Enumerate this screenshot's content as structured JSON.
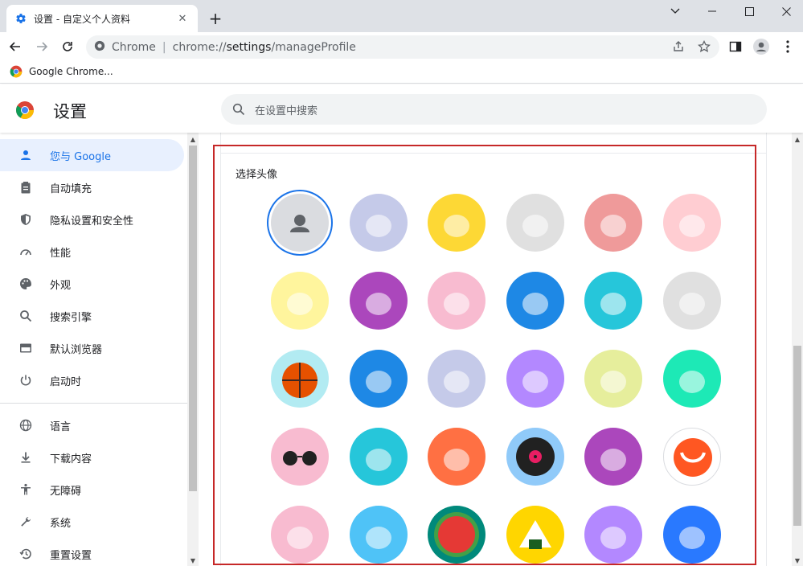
{
  "browser": {
    "tab_title": "设置 - 自定义个人资料",
    "omnibox_scheme": "Chrome",
    "omnibox_url_host": "chrome://",
    "omnibox_url_path": "settings",
    "omnibox_url_rest": "/manageProfile",
    "bookmark_label": "Google Chrome..."
  },
  "settings": {
    "title": "设置",
    "search_placeholder": "在设置中搜索"
  },
  "sidebar": {
    "items": [
      {
        "label": "您与 Google",
        "icon": "person-icon",
        "active": true
      },
      {
        "label": "自动填充",
        "icon": "clipboard-icon"
      },
      {
        "label": "隐私设置和安全性",
        "icon": "shield-icon"
      },
      {
        "label": "性能",
        "icon": "speedometer-icon"
      },
      {
        "label": "外观",
        "icon": "palette-icon"
      },
      {
        "label": "搜索引擎",
        "icon": "search-icon"
      },
      {
        "label": "默认浏览器",
        "icon": "browser-window-icon"
      },
      {
        "label": "启动时",
        "icon": "power-icon"
      },
      {
        "label": "语言",
        "icon": "globe-icon"
      },
      {
        "label": "下载内容",
        "icon": "download-icon"
      },
      {
        "label": "无障碍",
        "icon": "accessibility-icon"
      },
      {
        "label": "系统",
        "icon": "wrench-icon"
      },
      {
        "label": "重置设置",
        "icon": "restore-icon"
      }
    ]
  },
  "avatar_section": {
    "title": "选择头像",
    "avatars": [
      {
        "name": "default-person",
        "bg": "#dadce0",
        "selected": true
      },
      {
        "name": "cat",
        "bg": "#c5cae9"
      },
      {
        "name": "corgi",
        "bg": "#fdd835"
      },
      {
        "name": "dragon",
        "bg": "#e0e0e0"
      },
      {
        "name": "elephant",
        "bg": "#ef9a9a"
      },
      {
        "name": "fox",
        "bg": "#ffcdd2"
      },
      {
        "name": "monkey",
        "bg": "#fff59d"
      },
      {
        "name": "panda",
        "bg": "#ab47bc"
      },
      {
        "name": "penguin",
        "bg": "#f8bbd0"
      },
      {
        "name": "butterfly",
        "bg": "#1e88e5"
      },
      {
        "name": "rabbit",
        "bg": "#26c6da"
      },
      {
        "name": "unicorn",
        "bg": "#e0e0e0"
      },
      {
        "name": "basketball",
        "bg": "#b2ebf2"
      },
      {
        "name": "bike",
        "bg": "#1e88e5"
      },
      {
        "name": "bird",
        "bg": "#c5cae9"
      },
      {
        "name": "cheese",
        "bg": "#b388ff"
      },
      {
        "name": "football",
        "bg": "#e6ee9c"
      },
      {
        "name": "ramen",
        "bg": "#1de9b6"
      },
      {
        "name": "sunglasses",
        "bg": "#f8bbd0"
      },
      {
        "name": "sushi",
        "bg": "#26c6da"
      },
      {
        "name": "tamagotchi",
        "bg": "#ff7043"
      },
      {
        "name": "vinyl",
        "bg": "#90caf9"
      },
      {
        "name": "avocado",
        "bg": "#ab47bc"
      },
      {
        "name": "smile",
        "bg": "#ffffff"
      },
      {
        "name": "ice-cream",
        "bg": "#f8bbd0"
      },
      {
        "name": "box",
        "bg": "#4fc3f7"
      },
      {
        "name": "watermelon",
        "bg": "#00897b"
      },
      {
        "name": "onigiri",
        "bg": "#ffd600"
      },
      {
        "name": "pizza",
        "bg": "#b388ff"
      },
      {
        "name": "sandwich",
        "bg": "#2979ff"
      }
    ]
  },
  "colors": {
    "accent": "#1a73e8",
    "active_bg": "#e8f0fe",
    "highlight_border": "#c62828"
  }
}
